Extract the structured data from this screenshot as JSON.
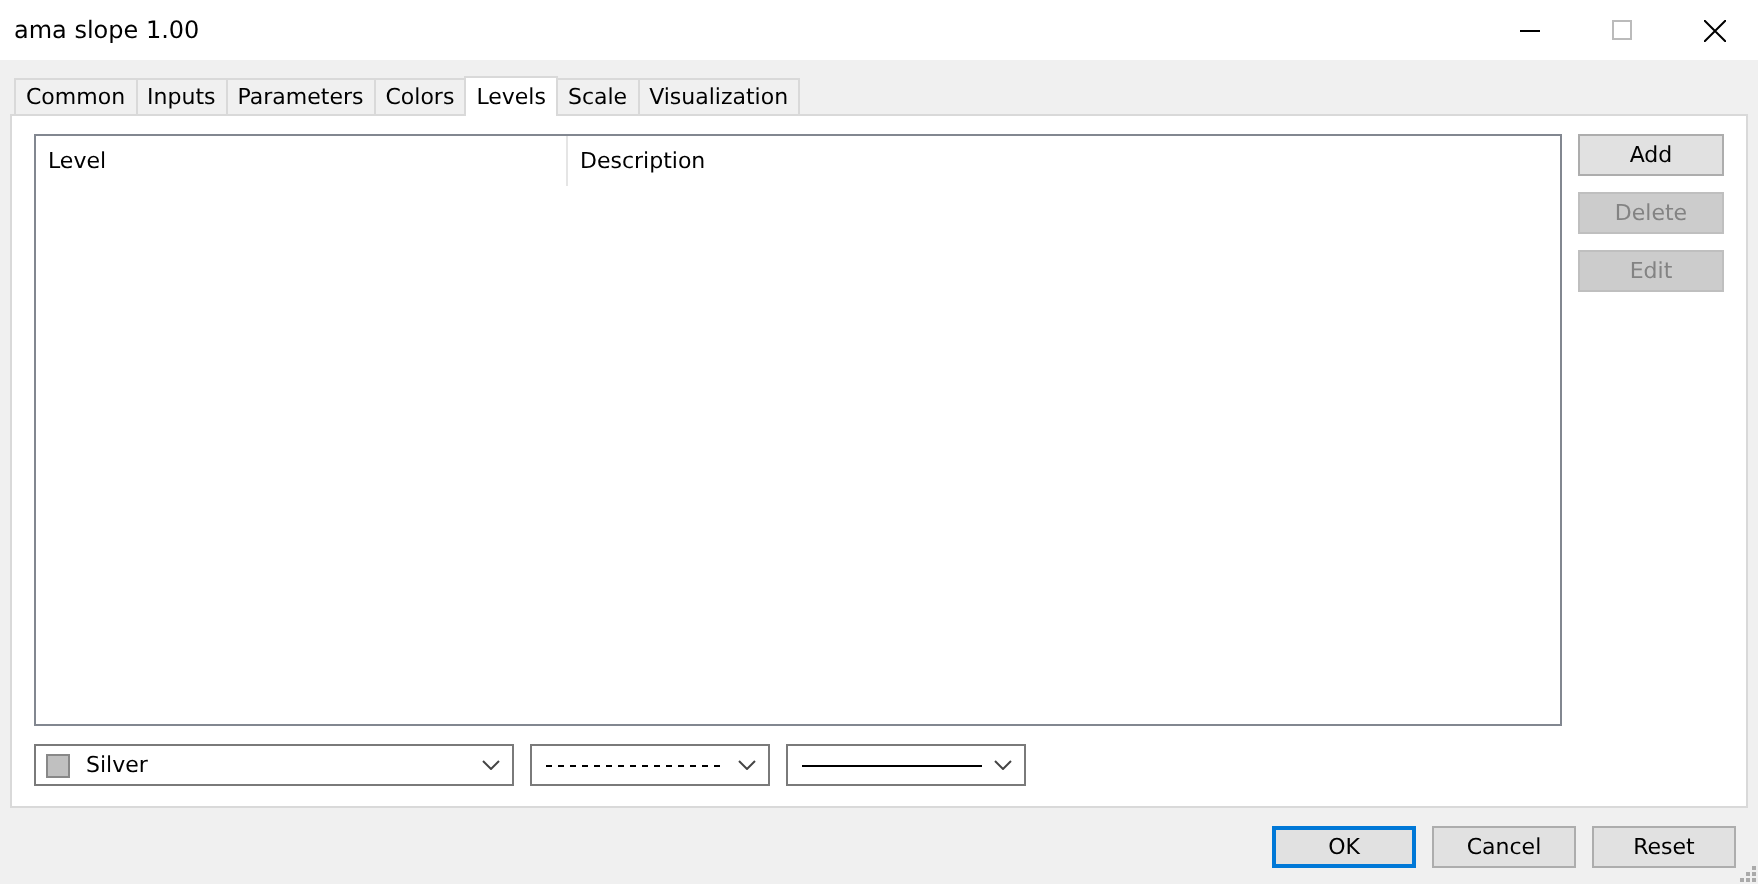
{
  "window": {
    "title": "ama slope 1.00"
  },
  "tabs": [
    {
      "label": "Common",
      "selected": false
    },
    {
      "label": "Inputs",
      "selected": false
    },
    {
      "label": "Parameters",
      "selected": false
    },
    {
      "label": "Colors",
      "selected": false
    },
    {
      "label": "Levels",
      "selected": true
    },
    {
      "label": "Scale",
      "selected": false
    },
    {
      "label": "Visualization",
      "selected": false
    }
  ],
  "levels_table": {
    "columns": [
      "Level",
      "Description"
    ]
  },
  "side_buttons": [
    {
      "label": "Add",
      "disabled": false
    },
    {
      "label": "Delete",
      "disabled": true
    },
    {
      "label": "Edit",
      "disabled": true
    }
  ],
  "color_select": {
    "value": "Silver",
    "color": "#c0c0c0"
  },
  "line_selects": [
    {
      "kind": "dashed"
    },
    {
      "kind": "solid"
    }
  ],
  "footer_buttons": [
    {
      "label": "OK",
      "default": true
    },
    {
      "label": "Cancel",
      "default": false
    },
    {
      "label": "Reset",
      "default": false
    }
  ]
}
